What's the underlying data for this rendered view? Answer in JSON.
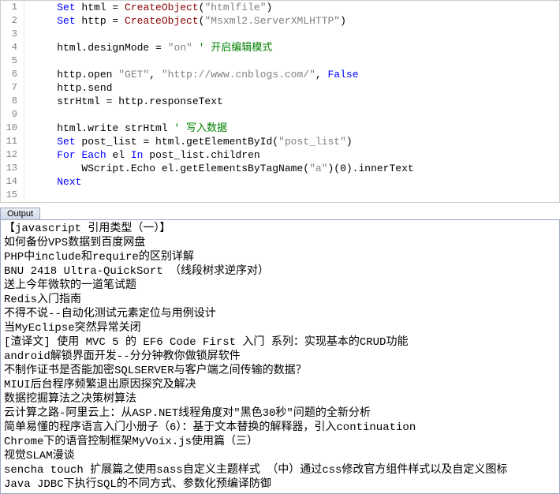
{
  "code": {
    "lines": [
      {
        "n": "1",
        "tokens": [
          {
            "t": "    ",
            "c": ""
          },
          {
            "t": "Set",
            "c": "kw"
          },
          {
            "t": " html = ",
            "c": "id"
          },
          {
            "t": "CreateObject",
            "c": "fn"
          },
          {
            "t": "(",
            "c": "id"
          },
          {
            "t": "\"htmlfile\"",
            "c": "str"
          },
          {
            "t": ")",
            "c": "id"
          }
        ]
      },
      {
        "n": "2",
        "tokens": [
          {
            "t": "    ",
            "c": ""
          },
          {
            "t": "Set",
            "c": "kw"
          },
          {
            "t": " http = ",
            "c": "id"
          },
          {
            "t": "CreateObject",
            "c": "fn"
          },
          {
            "t": "(",
            "c": "id"
          },
          {
            "t": "\"Msxml2.ServerXMLHTTP\"",
            "c": "str"
          },
          {
            "t": ")",
            "c": "id"
          }
        ]
      },
      {
        "n": "3",
        "tokens": []
      },
      {
        "n": "4",
        "tokens": [
          {
            "t": "    html.designMode = ",
            "c": "id"
          },
          {
            "t": "\"on\"",
            "c": "str"
          },
          {
            "t": " ",
            "c": ""
          },
          {
            "t": "' 开启编辑模式",
            "c": "cm"
          }
        ]
      },
      {
        "n": "5",
        "tokens": []
      },
      {
        "n": "6",
        "tokens": [
          {
            "t": "    http.open ",
            "c": "id"
          },
          {
            "t": "\"GET\"",
            "c": "str"
          },
          {
            "t": ", ",
            "c": "id"
          },
          {
            "t": "\"http://www.cnblogs.com/\"",
            "c": "str"
          },
          {
            "t": ", ",
            "c": "id"
          },
          {
            "t": "False",
            "c": "bool"
          }
        ]
      },
      {
        "n": "7",
        "tokens": [
          {
            "t": "    http.send",
            "c": "id"
          }
        ]
      },
      {
        "n": "8",
        "tokens": [
          {
            "t": "    strHtml = http.responseText",
            "c": "id"
          }
        ]
      },
      {
        "n": "9",
        "tokens": []
      },
      {
        "n": "10",
        "tokens": [
          {
            "t": "    html.write strHtml ",
            "c": "id"
          },
          {
            "t": "' 写入数据",
            "c": "cm"
          }
        ]
      },
      {
        "n": "11",
        "tokens": [
          {
            "t": "    ",
            "c": ""
          },
          {
            "t": "Set",
            "c": "kw"
          },
          {
            "t": " post_list = html.getElementById(",
            "c": "id"
          },
          {
            "t": "\"post_list\"",
            "c": "str"
          },
          {
            "t": ")",
            "c": "id"
          }
        ]
      },
      {
        "n": "12",
        "tokens": [
          {
            "t": "    ",
            "c": ""
          },
          {
            "t": "For",
            "c": "kw"
          },
          {
            "t": " ",
            "c": ""
          },
          {
            "t": "Each",
            "c": "kw"
          },
          {
            "t": " el ",
            "c": "id"
          },
          {
            "t": "In",
            "c": "kw"
          },
          {
            "t": " post_list.children",
            "c": "id"
          }
        ]
      },
      {
        "n": "13",
        "tokens": [
          {
            "t": "        WScript.Echo el.getElementsByTagName(",
            "c": "id"
          },
          {
            "t": "\"a\"",
            "c": "str"
          },
          {
            "t": ")(0).innerText",
            "c": "id"
          }
        ]
      },
      {
        "n": "14",
        "tokens": [
          {
            "t": "    ",
            "c": ""
          },
          {
            "t": "Next",
            "c": "kw"
          }
        ]
      },
      {
        "n": "15",
        "tokens": []
      }
    ]
  },
  "output": {
    "tab_label": "Output",
    "lines": [
      "【javascript 引用类型（一）】",
      "如何备份VPS数据到百度网盘",
      "PHP中include和require的区别详解",
      "BNU 2418 Ultra-QuickSort （线段树求逆序对）",
      "送上今年微软的一道笔试题",
      "Redis入门指南",
      "不得不说--自动化测试元素定位与用例设计",
      "当MyEclipse突然异常关闭",
      "[渣译文] 使用 MVC 5 的 EF6 Code First 入门 系列：实现基本的CRUD功能",
      "android解锁界面开发--分分钟教你做锁屏软件",
      "不制作证书是否能加密SQLSERVER与客户端之间传输的数据？",
      "MIUI后台程序频繁退出原因探究及解决",
      "数据挖掘算法之决策树算法",
      "云计算之路-阿里云上：从ASP.NET线程角度对\"黑色30秒\"问题的全新分析",
      "简单易懂的程序语言入门小册子（6）：基于文本替换的解释器，引入continuation",
      "Chrome下的语音控制框架MyVoix.js使用篇（三）",
      "视觉SLAM漫谈",
      "sencha touch 扩展篇之使用sass自定义主题样式 （中）通过css修改官方组件样式以及自定义图标",
      "Java JDBC下执行SQL的不同方式、参数化预编译防御"
    ]
  }
}
